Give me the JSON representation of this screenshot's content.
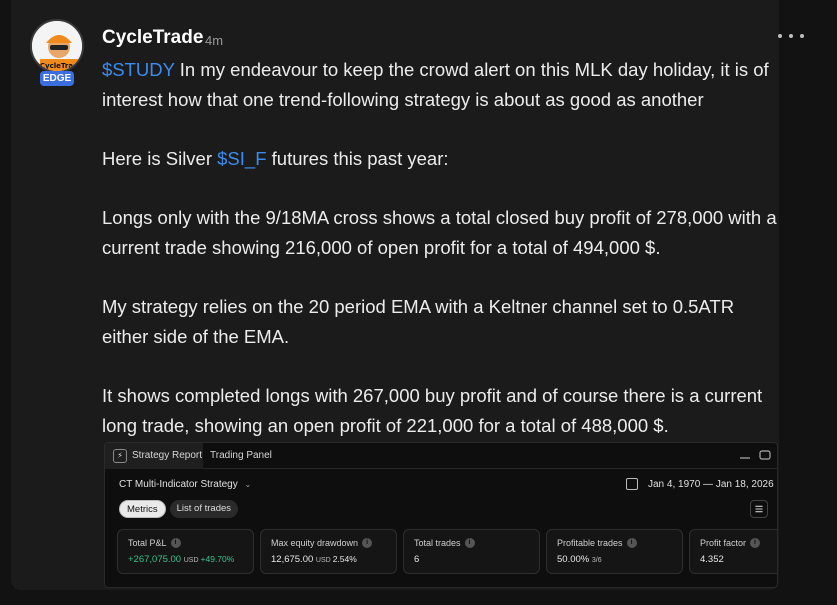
{
  "author": {
    "name": "CycleTrade",
    "time": "4m",
    "badge": "EDGE",
    "avatar_text": "CycleTrad"
  },
  "post": {
    "p1_ticker": "$STUDY",
    "p1_text": " In my endeavour to keep the crowd alert on this MLK day holiday, it is of interest how that one trend-following strategy is about as good as another",
    "p2_pre": "Here is Silver ",
    "p2_ticker": "$SI_F",
    "p2_post": " futures this past year:",
    "p3": "Longs only with the 9/18MA cross shows a total closed buy profit of 278,000 with a current trade showing 216,000 of open profit for a total of 494,000 $.",
    "p4": "My strategy relies on the 20 period EMA with a Keltner channel set to 0.5ATR either side of the EMA.",
    "p5": "It shows completed longs with 267,000 buy profit and of course there is a current long trade, showing  an open profit of 221,000 for a total of 488,000 $."
  },
  "panel": {
    "tabs": [
      "Strategy Report",
      "Trading Panel"
    ],
    "strategy_name": "CT Multi-Indicator Strategy",
    "date_range": "Jan 4, 1970 — Jan 18, 2026",
    "filters": [
      "Metrics",
      "List of trades"
    ],
    "metrics": [
      {
        "label": "Total P&L",
        "value": "+267,075.00",
        "unit": "USD",
        "sub": "+49.70%"
      },
      {
        "label": "Max equity drawdown",
        "value": "12,675.00",
        "unit": "USD",
        "sub": "2.54%"
      },
      {
        "label": "Total trades",
        "value": "6",
        "unit": "",
        "sub": ""
      },
      {
        "label": "Profitable trades",
        "value": "50.00%",
        "unit": "3/6",
        "sub": ""
      },
      {
        "label": "Profit factor",
        "value": "4.352",
        "unit": "",
        "sub": ""
      }
    ]
  },
  "colors": {
    "ticker": "#3b8cf0",
    "profit": "#39c08a",
    "badge": "#3b6fe0"
  }
}
